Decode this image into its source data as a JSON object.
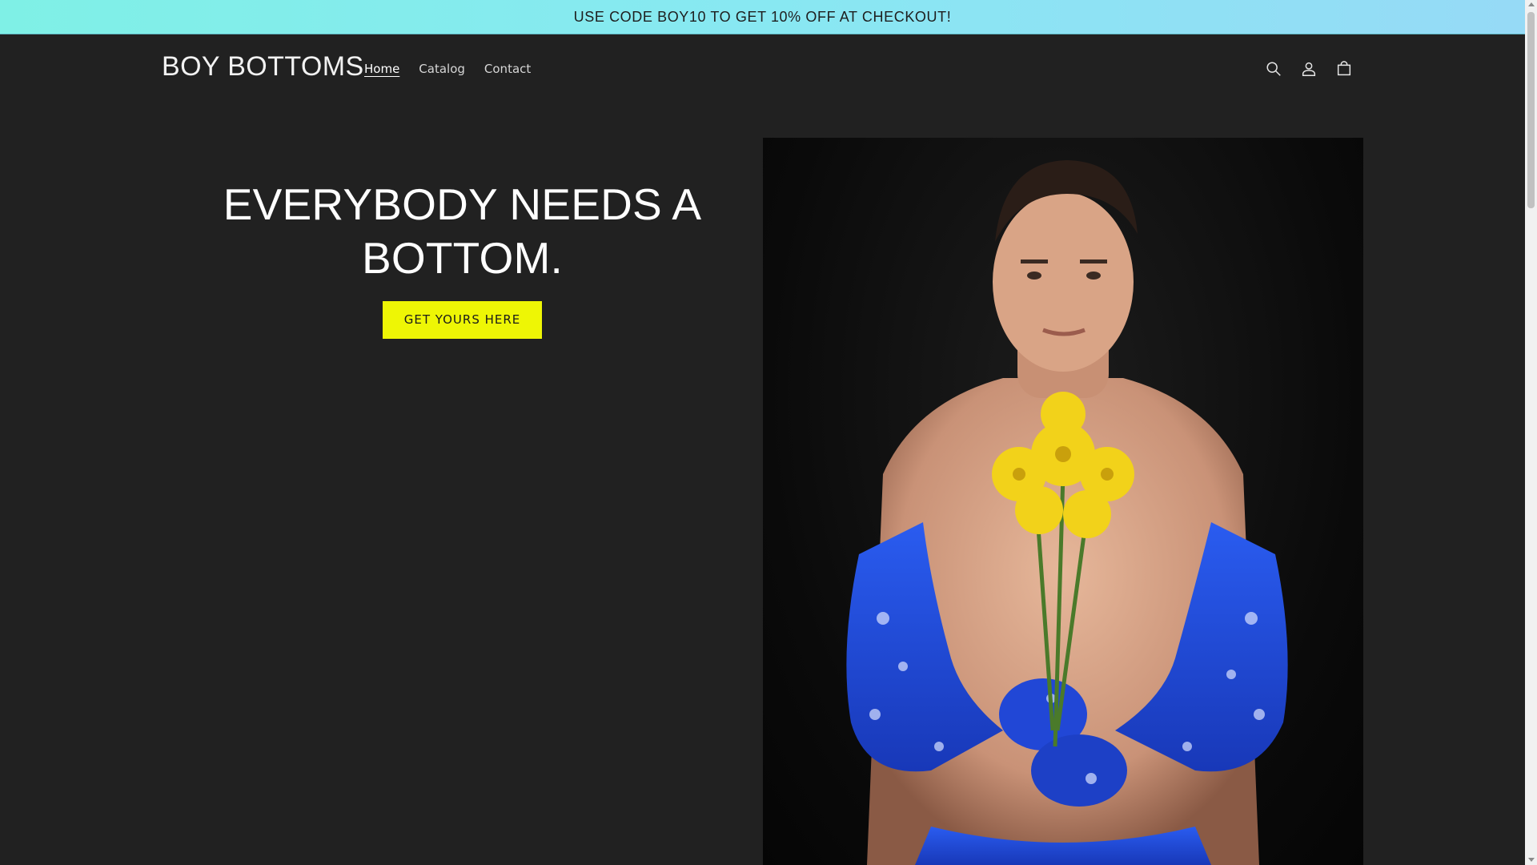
{
  "announcement": {
    "text": "USE CODE BOY10 TO GET 10% OFF AT CHECKOUT!"
  },
  "header": {
    "logo": "BOY BOTTOMS",
    "nav": [
      {
        "label": "Home",
        "active": true
      },
      {
        "label": "Catalog",
        "active": false
      },
      {
        "label": "Contact",
        "active": false
      }
    ],
    "icons": [
      "search-icon",
      "account-icon",
      "cart-icon"
    ]
  },
  "hero": {
    "heading_line1": "EVERYBODY NEEDS A",
    "heading_line2": "BOTTOM.",
    "cta_label": "GET YOURS HERE"
  },
  "colors": {
    "background": "#212121",
    "announcement_gradient_start": "#7ff0e6",
    "announcement_gradient_end": "#96daf6",
    "cta_background": "#eef605",
    "garment_blue": "#1f4fd8",
    "flowers_yellow": "#f2d21a"
  }
}
